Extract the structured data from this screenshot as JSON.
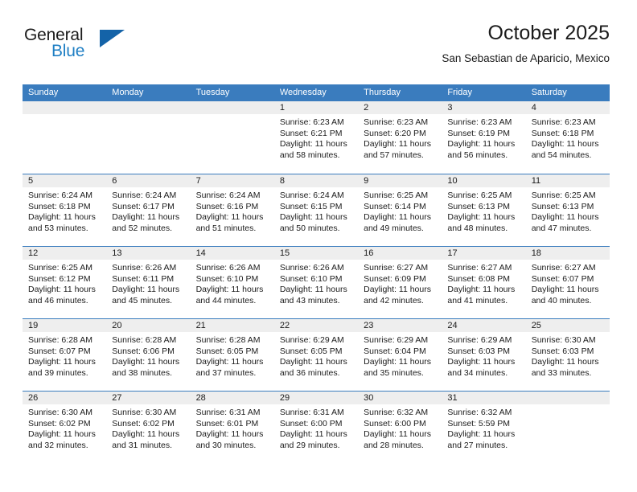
{
  "brand": {
    "name_top": "General",
    "name_bottom": "Blue",
    "triangle_icon": "blue-triangle-logo-mark",
    "accent_color": "#1463a8",
    "text_color": "#1f7fc4"
  },
  "header": {
    "title": "October 2025",
    "subtitle": "San Sebastian de Aparicio, Mexico"
  },
  "calendar": {
    "header_bg": "#3a7cbe",
    "daynum_bg": "#eeeeee",
    "weekdays": [
      "Sunday",
      "Monday",
      "Tuesday",
      "Wednesday",
      "Thursday",
      "Friday",
      "Saturday"
    ],
    "weeks": [
      [
        {
          "day": "",
          "lines": []
        },
        {
          "day": "",
          "lines": []
        },
        {
          "day": "",
          "lines": []
        },
        {
          "day": "1",
          "lines": [
            "Sunrise: 6:23 AM",
            "Sunset: 6:21 PM",
            "Daylight: 11 hours",
            "and 58 minutes."
          ]
        },
        {
          "day": "2",
          "lines": [
            "Sunrise: 6:23 AM",
            "Sunset: 6:20 PM",
            "Daylight: 11 hours",
            "and 57 minutes."
          ]
        },
        {
          "day": "3",
          "lines": [
            "Sunrise: 6:23 AM",
            "Sunset: 6:19 PM",
            "Daylight: 11 hours",
            "and 56 minutes."
          ]
        },
        {
          "day": "4",
          "lines": [
            "Sunrise: 6:23 AM",
            "Sunset: 6:18 PM",
            "Daylight: 11 hours",
            "and 54 minutes."
          ]
        }
      ],
      [
        {
          "day": "5",
          "lines": [
            "Sunrise: 6:24 AM",
            "Sunset: 6:18 PM",
            "Daylight: 11 hours",
            "and 53 minutes."
          ]
        },
        {
          "day": "6",
          "lines": [
            "Sunrise: 6:24 AM",
            "Sunset: 6:17 PM",
            "Daylight: 11 hours",
            "and 52 minutes."
          ]
        },
        {
          "day": "7",
          "lines": [
            "Sunrise: 6:24 AM",
            "Sunset: 6:16 PM",
            "Daylight: 11 hours",
            "and 51 minutes."
          ]
        },
        {
          "day": "8",
          "lines": [
            "Sunrise: 6:24 AM",
            "Sunset: 6:15 PM",
            "Daylight: 11 hours",
            "and 50 minutes."
          ]
        },
        {
          "day": "9",
          "lines": [
            "Sunrise: 6:25 AM",
            "Sunset: 6:14 PM",
            "Daylight: 11 hours",
            "and 49 minutes."
          ]
        },
        {
          "day": "10",
          "lines": [
            "Sunrise: 6:25 AM",
            "Sunset: 6:13 PM",
            "Daylight: 11 hours",
            "and 48 minutes."
          ]
        },
        {
          "day": "11",
          "lines": [
            "Sunrise: 6:25 AM",
            "Sunset: 6:13 PM",
            "Daylight: 11 hours",
            "and 47 minutes."
          ]
        }
      ],
      [
        {
          "day": "12",
          "lines": [
            "Sunrise: 6:25 AM",
            "Sunset: 6:12 PM",
            "Daylight: 11 hours",
            "and 46 minutes."
          ]
        },
        {
          "day": "13",
          "lines": [
            "Sunrise: 6:26 AM",
            "Sunset: 6:11 PM",
            "Daylight: 11 hours",
            "and 45 minutes."
          ]
        },
        {
          "day": "14",
          "lines": [
            "Sunrise: 6:26 AM",
            "Sunset: 6:10 PM",
            "Daylight: 11 hours",
            "and 44 minutes."
          ]
        },
        {
          "day": "15",
          "lines": [
            "Sunrise: 6:26 AM",
            "Sunset: 6:10 PM",
            "Daylight: 11 hours",
            "and 43 minutes."
          ]
        },
        {
          "day": "16",
          "lines": [
            "Sunrise: 6:27 AM",
            "Sunset: 6:09 PM",
            "Daylight: 11 hours",
            "and 42 minutes."
          ]
        },
        {
          "day": "17",
          "lines": [
            "Sunrise: 6:27 AM",
            "Sunset: 6:08 PM",
            "Daylight: 11 hours",
            "and 41 minutes."
          ]
        },
        {
          "day": "18",
          "lines": [
            "Sunrise: 6:27 AM",
            "Sunset: 6:07 PM",
            "Daylight: 11 hours",
            "and 40 minutes."
          ]
        }
      ],
      [
        {
          "day": "19",
          "lines": [
            "Sunrise: 6:28 AM",
            "Sunset: 6:07 PM",
            "Daylight: 11 hours",
            "and 39 minutes."
          ]
        },
        {
          "day": "20",
          "lines": [
            "Sunrise: 6:28 AM",
            "Sunset: 6:06 PM",
            "Daylight: 11 hours",
            "and 38 minutes."
          ]
        },
        {
          "day": "21",
          "lines": [
            "Sunrise: 6:28 AM",
            "Sunset: 6:05 PM",
            "Daylight: 11 hours",
            "and 37 minutes."
          ]
        },
        {
          "day": "22",
          "lines": [
            "Sunrise: 6:29 AM",
            "Sunset: 6:05 PM",
            "Daylight: 11 hours",
            "and 36 minutes."
          ]
        },
        {
          "day": "23",
          "lines": [
            "Sunrise: 6:29 AM",
            "Sunset: 6:04 PM",
            "Daylight: 11 hours",
            "and 35 minutes."
          ]
        },
        {
          "day": "24",
          "lines": [
            "Sunrise: 6:29 AM",
            "Sunset: 6:03 PM",
            "Daylight: 11 hours",
            "and 34 minutes."
          ]
        },
        {
          "day": "25",
          "lines": [
            "Sunrise: 6:30 AM",
            "Sunset: 6:03 PM",
            "Daylight: 11 hours",
            "and 33 minutes."
          ]
        }
      ],
      [
        {
          "day": "26",
          "lines": [
            "Sunrise: 6:30 AM",
            "Sunset: 6:02 PM",
            "Daylight: 11 hours",
            "and 32 minutes."
          ]
        },
        {
          "day": "27",
          "lines": [
            "Sunrise: 6:30 AM",
            "Sunset: 6:02 PM",
            "Daylight: 11 hours",
            "and 31 minutes."
          ]
        },
        {
          "day": "28",
          "lines": [
            "Sunrise: 6:31 AM",
            "Sunset: 6:01 PM",
            "Daylight: 11 hours",
            "and 30 minutes."
          ]
        },
        {
          "day": "29",
          "lines": [
            "Sunrise: 6:31 AM",
            "Sunset: 6:00 PM",
            "Daylight: 11 hours",
            "and 29 minutes."
          ]
        },
        {
          "day": "30",
          "lines": [
            "Sunrise: 6:32 AM",
            "Sunset: 6:00 PM",
            "Daylight: 11 hours",
            "and 28 minutes."
          ]
        },
        {
          "day": "31",
          "lines": [
            "Sunrise: 6:32 AM",
            "Sunset: 5:59 PM",
            "Daylight: 11 hours",
            "and 27 minutes."
          ]
        },
        {
          "day": "",
          "lines": []
        }
      ]
    ]
  }
}
